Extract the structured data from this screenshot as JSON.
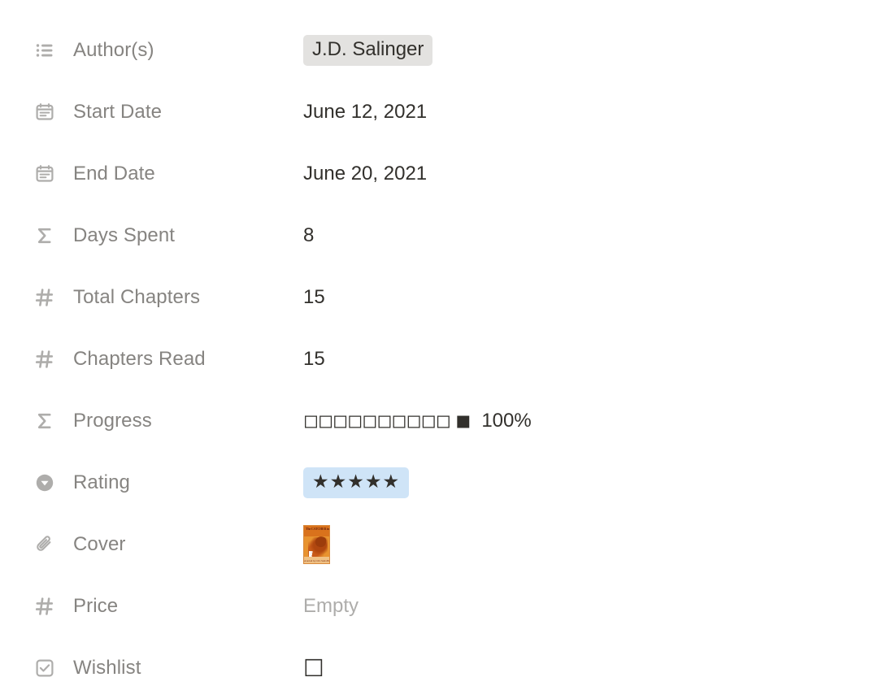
{
  "panel": {
    "rows": [
      {
        "icon": "multi-select-list-icon",
        "label": "Author(s)",
        "value_type": "tag",
        "value": "J.D. Salinger",
        "tag_color": "#e3e2e0"
      },
      {
        "icon": "calendar-icon",
        "label": "Start Date",
        "value_type": "text",
        "value": "June 12, 2021"
      },
      {
        "icon": "calendar-icon",
        "label": "End Date",
        "value_type": "text",
        "value": "June 20, 2021"
      },
      {
        "icon": "sigma-formula-icon",
        "label": "Days Spent",
        "value_type": "text",
        "value": "8"
      },
      {
        "icon": "number-hash-icon",
        "label": "Total Chapters",
        "value_type": "text",
        "value": "15"
      },
      {
        "icon": "number-hash-icon",
        "label": "Chapters Read",
        "value_type": "text",
        "value": "15"
      },
      {
        "icon": "sigma-formula-icon",
        "label": "Progress",
        "value_type": "progress",
        "blocks": "◻◻◻◻◻◻◻◻◻◻ ◼",
        "percent": "100%"
      },
      {
        "icon": "select-dropdown-icon",
        "label": "Rating",
        "value_type": "rating",
        "stars": "★★★★★",
        "tag_color": "#cfe4f7"
      },
      {
        "icon": "paperclip-icon",
        "label": "Cover",
        "value_type": "image",
        "cover_title": "The CATCHER in the RYE",
        "cover_author": "A novel by J.D. SALINGER"
      },
      {
        "icon": "number-hash-icon",
        "label": "Price",
        "value_type": "empty",
        "value": "Empty"
      },
      {
        "icon": "checkbox-property-icon",
        "label": "Wishlist",
        "value_type": "checkbox",
        "value": "☐"
      }
    ]
  }
}
